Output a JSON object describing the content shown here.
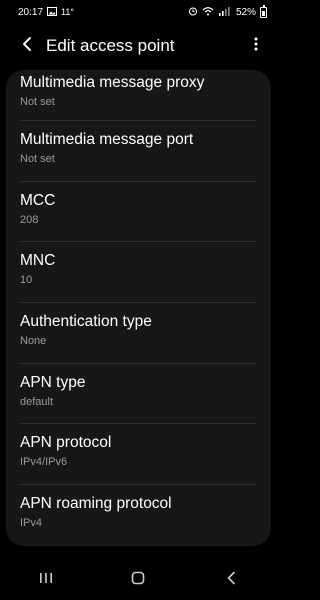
{
  "status_bar": {
    "time": "20:17",
    "temperature": "11°",
    "battery": "52%",
    "icons": [
      "gallery-icon",
      "alarm-icon",
      "wifi-icon",
      "signal-icon",
      "battery-icon"
    ]
  },
  "header": {
    "title": "Edit access point",
    "back_icon": "chevron-left-icon",
    "more_icon": "more-vertical-icon"
  },
  "settings": [
    {
      "label": "Multimedia message proxy",
      "value": "Not set"
    },
    {
      "label": "Multimedia message port",
      "value": "Not set"
    },
    {
      "label": "MCC",
      "value": "208"
    },
    {
      "label": "MNC",
      "value": "10"
    },
    {
      "label": "Authentication type",
      "value": "None"
    },
    {
      "label": "APN type",
      "value": "default"
    },
    {
      "label": "APN protocol",
      "value": "IPv4/IPv6"
    },
    {
      "label": "APN roaming protocol",
      "value": "IPv4"
    }
  ],
  "nav_bar": {
    "icons": [
      "recent-apps-icon",
      "home-icon",
      "back-icon"
    ]
  },
  "colors": {
    "background": "#000000",
    "card": "#171717",
    "primary_text": "#ffffff",
    "secondary_text": "#9a9a9a",
    "divider": "#2e2e2e"
  }
}
